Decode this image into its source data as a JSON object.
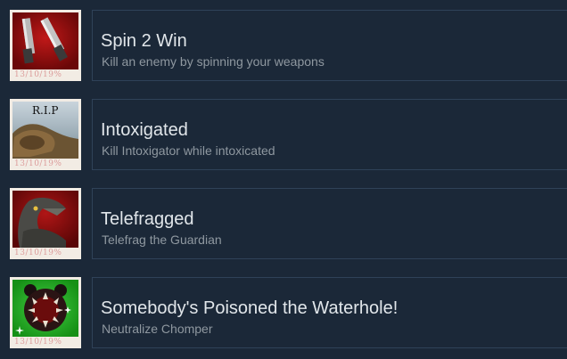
{
  "achievements": [
    {
      "title": "Spin 2 Win",
      "description": "Kill an enemy by spinning your weapons",
      "stamp": "13/10/19%"
    },
    {
      "title": "Intoxigated",
      "description": "Kill Intoxigator while intoxicated",
      "stamp": "13/10/19%",
      "icon_text": "R.I.P"
    },
    {
      "title": "Telefragged",
      "description": "Telefrag the Guardian",
      "stamp": "13/10/19%"
    },
    {
      "title": "Somebody's Poisoned the Waterhole!",
      "description": "Neutralize Chomper",
      "stamp": "13/10/19%"
    }
  ],
  "icons": [
    "dual-pistols-icon",
    "rip-tombstone-icon",
    "guardian-creature-icon",
    "chomper-monster-icon"
  ],
  "colors": {
    "background": "#1b2838",
    "card_border": "#2f4258",
    "title": "#e1e6ea",
    "description": "#8f98a0"
  }
}
